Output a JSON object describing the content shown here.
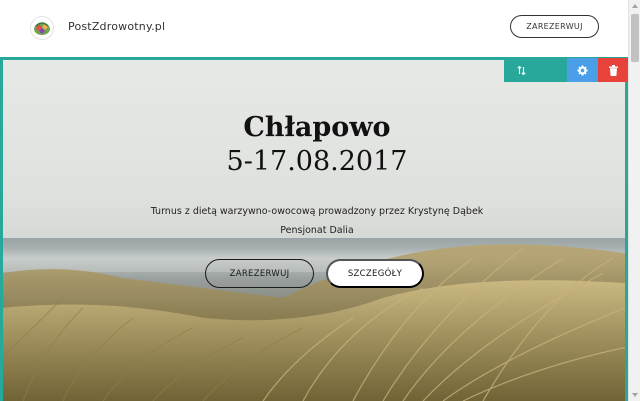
{
  "header": {
    "brand": "PostZdrowotny.pl",
    "cta_label": "ZAREZERWUJ"
  },
  "toolbar": {
    "move_icon": "move-vertical-icon",
    "settings_icon": "gear-icon",
    "delete_icon": "trash-icon"
  },
  "hero": {
    "title": "Chłapowo",
    "dates": "5-17.08.2017",
    "description_line1": "Turnus z dietą warzywno-owocową prowadzony przez Krystynę Dąbek",
    "description_line2": "Pensjonat Dalia",
    "reserve_label": "ZAREZERWUJ",
    "details_label": "SZCZEGÓŁY"
  },
  "colors": {
    "accent": "#27a89a",
    "settings": "#4a9fe8",
    "delete": "#e8433b"
  }
}
